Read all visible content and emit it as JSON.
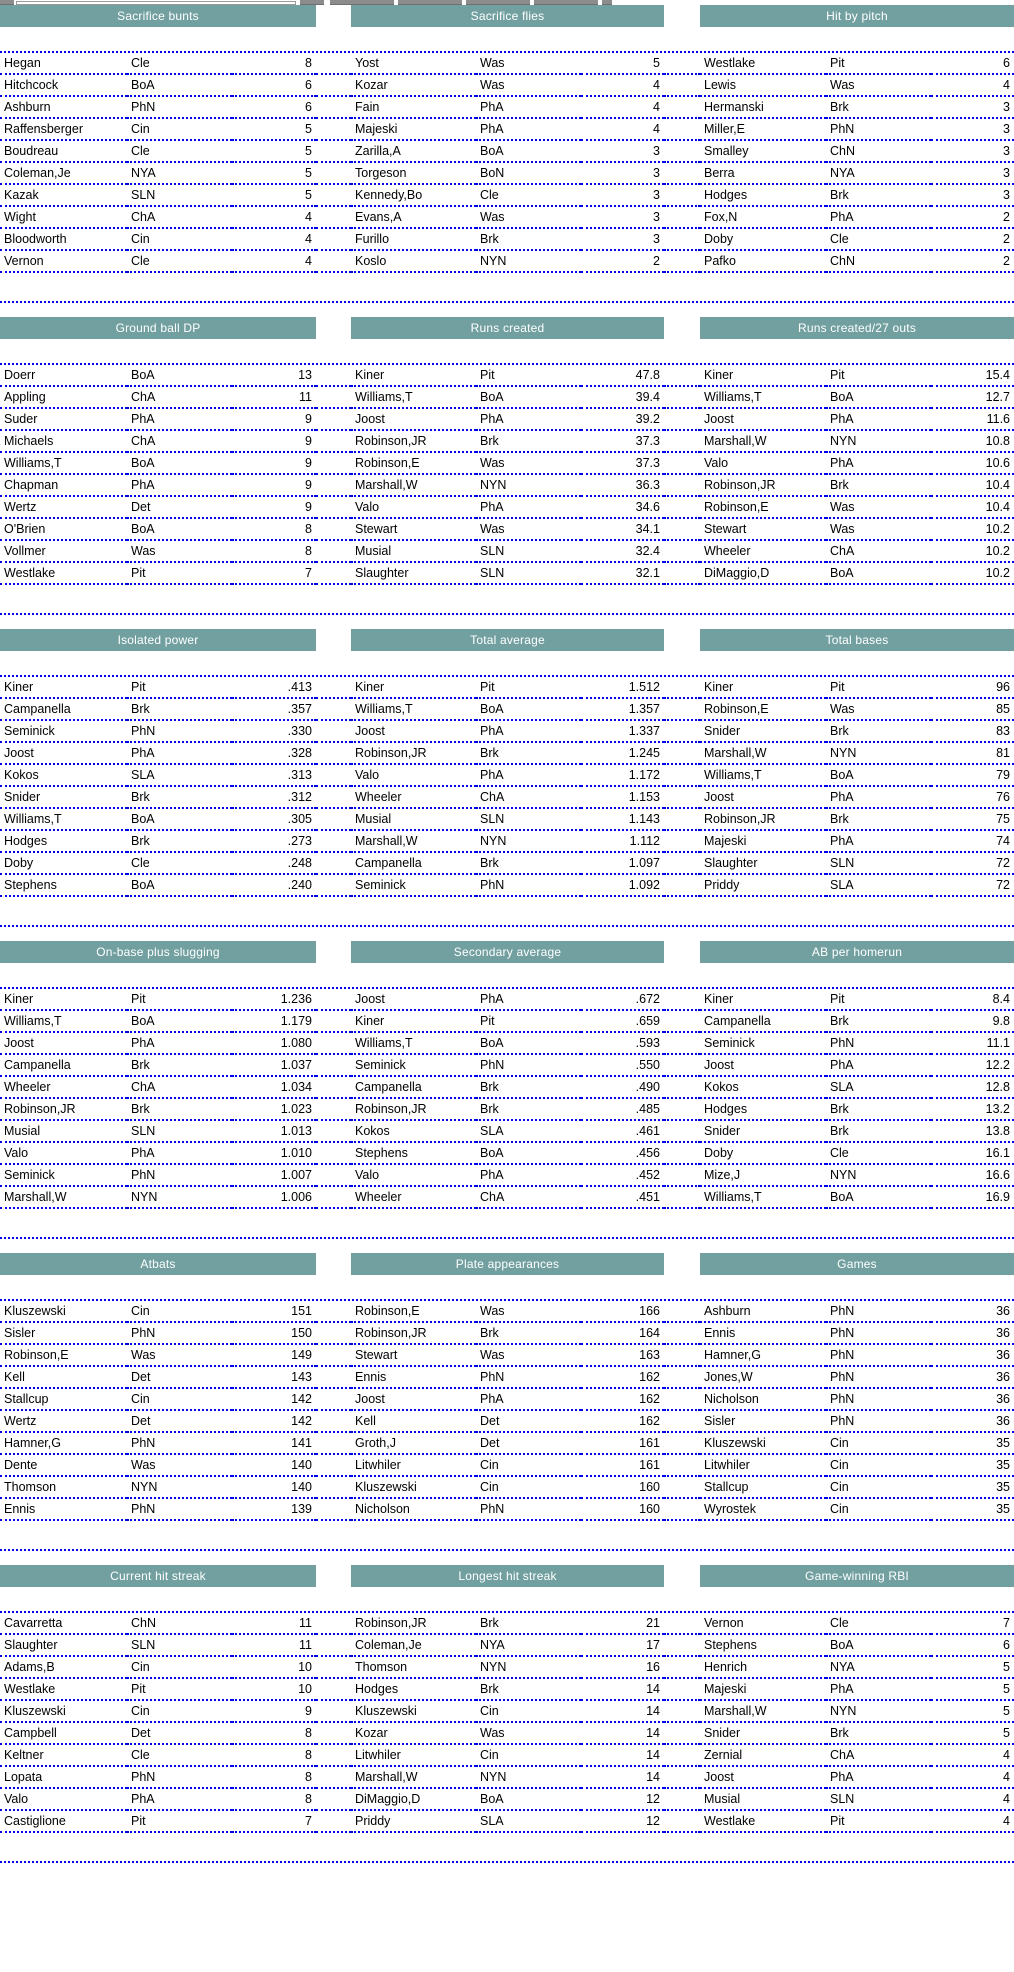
{
  "colors": {
    "header_teal": "#72a0a0",
    "grid_blue": "#0000ee",
    "text": "#000000"
  },
  "chrome": {
    "present": true
  },
  "sections": [
    {
      "id": "sec1",
      "titles": [
        "Sacrifice bunts",
        "Sacrifice flies",
        "Hit by pitch"
      ],
      "rows": [
        [
          "Hegan",
          "Cle",
          "8",
          "Yost",
          "Was",
          "5",
          "Westlake",
          "Pit",
          "6"
        ],
        [
          "Hitchcock",
          "BoA",
          "6",
          "Kozar",
          "Was",
          "4",
          "Lewis",
          "Was",
          "4"
        ],
        [
          "Ashburn",
          "PhN",
          "6",
          "Fain",
          "PhA",
          "4",
          "Hermanski",
          "Brk",
          "3"
        ],
        [
          "Raffensberger",
          "Cin",
          "5",
          "Majeski",
          "PhA",
          "4",
          "Miller,E",
          "PhN",
          "3"
        ],
        [
          "Boudreau",
          "Cle",
          "5",
          "Zarilla,A",
          "BoA",
          "3",
          "Smalley",
          "ChN",
          "3"
        ],
        [
          "Coleman,Je",
          "NYA",
          "5",
          "Torgeson",
          "BoN",
          "3",
          "Berra",
          "NYA",
          "3"
        ],
        [
          "Kazak",
          "SLN",
          "5",
          "Kennedy,Bo",
          "Cle",
          "3",
          "Hodges",
          "Brk",
          "3"
        ],
        [
          "Wight",
          "ChA",
          "4",
          "Evans,A",
          "Was",
          "3",
          "Fox,N",
          "PhA",
          "2"
        ],
        [
          "Bloodworth",
          "Cin",
          "4",
          "Furillo",
          "Brk",
          "3",
          "Doby",
          "Cle",
          "2"
        ],
        [
          "Vernon",
          "Cle",
          "4",
          "Koslo",
          "NYN",
          "2",
          "Pafko",
          "ChN",
          "2"
        ]
      ]
    },
    {
      "id": "sec2",
      "titles": [
        "Ground ball DP",
        "Runs created",
        "Runs created/27 outs"
      ],
      "rows": [
        [
          "Doerr",
          "BoA",
          "13",
          "Kiner",
          "Pit",
          "47.8",
          "Kiner",
          "Pit",
          "15.4"
        ],
        [
          "Appling",
          "ChA",
          "11",
          "Williams,T",
          "BoA",
          "39.4",
          "Williams,T",
          "BoA",
          "12.7"
        ],
        [
          "Suder",
          "PhA",
          "9",
          "Joost",
          "PhA",
          "39.2",
          "Joost",
          "PhA",
          "11.6"
        ],
        [
          "Michaels",
          "ChA",
          "9",
          "Robinson,JR",
          "Brk",
          "37.3",
          "Marshall,W",
          "NYN",
          "10.8"
        ],
        [
          "Williams,T",
          "BoA",
          "9",
          "Robinson,E",
          "Was",
          "37.3",
          "Valo",
          "PhA",
          "10.6"
        ],
        [
          "Chapman",
          "PhA",
          "9",
          "Marshall,W",
          "NYN",
          "36.3",
          "Robinson,JR",
          "Brk",
          "10.4"
        ],
        [
          "Wertz",
          "Det",
          "9",
          "Valo",
          "PhA",
          "34.6",
          "Robinson,E",
          "Was",
          "10.4"
        ],
        [
          "O'Brien",
          "BoA",
          "8",
          "Stewart",
          "Was",
          "34.1",
          "Stewart",
          "Was",
          "10.2"
        ],
        [
          "Vollmer",
          "Was",
          "8",
          "Musial",
          "SLN",
          "32.4",
          "Wheeler",
          "ChA",
          "10.2"
        ],
        [
          "Westlake",
          "Pit",
          "7",
          "Slaughter",
          "SLN",
          "32.1",
          "DiMaggio,D",
          "BoA",
          "10.2"
        ]
      ]
    },
    {
      "id": "sec3",
      "titles": [
        "Isolated power",
        "Total average",
        "Total bases"
      ],
      "rows": [
        [
          "Kiner",
          "Pit",
          ".413",
          "Kiner",
          "Pit",
          "1.512",
          "Kiner",
          "Pit",
          "96"
        ],
        [
          "Campanella",
          "Brk",
          ".357",
          "Williams,T",
          "BoA",
          "1.357",
          "Robinson,E",
          "Was",
          "85"
        ],
        [
          "Seminick",
          "PhN",
          ".330",
          "Joost",
          "PhA",
          "1.337",
          "Snider",
          "Brk",
          "83"
        ],
        [
          "Joost",
          "PhA",
          ".328",
          "Robinson,JR",
          "Brk",
          "1.245",
          "Marshall,W",
          "NYN",
          "81"
        ],
        [
          "Kokos",
          "SLA",
          ".313",
          "Valo",
          "PhA",
          "1.172",
          "Williams,T",
          "BoA",
          "79"
        ],
        [
          "Snider",
          "Brk",
          ".312",
          "Wheeler",
          "ChA",
          "1.153",
          "Joost",
          "PhA",
          "76"
        ],
        [
          "Williams,T",
          "BoA",
          ".305",
          "Musial",
          "SLN",
          "1.143",
          "Robinson,JR",
          "Brk",
          "75"
        ],
        [
          "Hodges",
          "Brk",
          ".273",
          "Marshall,W",
          "NYN",
          "1.112",
          "Majeski",
          "PhA",
          "74"
        ],
        [
          "Doby",
          "Cle",
          ".248",
          "Campanella",
          "Brk",
          "1.097",
          "Slaughter",
          "SLN",
          "72"
        ],
        [
          "Stephens",
          "BoA",
          ".240",
          "Seminick",
          "PhN",
          "1.092",
          "Priddy",
          "SLA",
          "72"
        ]
      ]
    },
    {
      "id": "sec4",
      "titles": [
        "On-base plus slugging",
        "Secondary average",
        "AB per homerun"
      ],
      "rows": [
        [
          "Kiner",
          "Pit",
          "1.236",
          "Joost",
          "PhA",
          ".672",
          "Kiner",
          "Pit",
          "8.4"
        ],
        [
          "Williams,T",
          "BoA",
          "1.179",
          "Kiner",
          "Pit",
          ".659",
          "Campanella",
          "Brk",
          "9.8"
        ],
        [
          "Joost",
          "PhA",
          "1.080",
          "Williams,T",
          "BoA",
          ".593",
          "Seminick",
          "PhN",
          "11.1"
        ],
        [
          "Campanella",
          "Brk",
          "1.037",
          "Seminick",
          "PhN",
          ".550",
          "Joost",
          "PhA",
          "12.2"
        ],
        [
          "Wheeler",
          "ChA",
          "1.034",
          "Campanella",
          "Brk",
          ".490",
          "Kokos",
          "SLA",
          "12.8"
        ],
        [
          "Robinson,JR",
          "Brk",
          "1.023",
          "Robinson,JR",
          "Brk",
          ".485",
          "Hodges",
          "Brk",
          "13.2"
        ],
        [
          "Musial",
          "SLN",
          "1.013",
          "Kokos",
          "SLA",
          ".461",
          "Snider",
          "Brk",
          "13.8"
        ],
        [
          "Valo",
          "PhA",
          "1.010",
          "Stephens",
          "BoA",
          ".456",
          "Doby",
          "Cle",
          "16.1"
        ],
        [
          "Seminick",
          "PhN",
          "1.007",
          "Valo",
          "PhA",
          ".452",
          "Mize,J",
          "NYN",
          "16.6"
        ],
        [
          "Marshall,W",
          "NYN",
          "1.006",
          "Wheeler",
          "ChA",
          ".451",
          "Williams,T",
          "BoA",
          "16.9"
        ]
      ]
    },
    {
      "id": "sec5",
      "titles": [
        "Atbats",
        "Plate appearances",
        "Games"
      ],
      "rows": [
        [
          "Kluszewski",
          "Cin",
          "151",
          "Robinson,E",
          "Was",
          "166",
          "Ashburn",
          "PhN",
          "36"
        ],
        [
          "Sisler",
          "PhN",
          "150",
          "Robinson,JR",
          "Brk",
          "164",
          "Ennis",
          "PhN",
          "36"
        ],
        [
          "Robinson,E",
          "Was",
          "149",
          "Stewart",
          "Was",
          "163",
          "Hamner,G",
          "PhN",
          "36"
        ],
        [
          "Kell",
          "Det",
          "143",
          "Ennis",
          "PhN",
          "162",
          "Jones,W",
          "PhN",
          "36"
        ],
        [
          "Stallcup",
          "Cin",
          "142",
          "Joost",
          "PhA",
          "162",
          "Nicholson",
          "PhN",
          "36"
        ],
        [
          "Wertz",
          "Det",
          "142",
          "Kell",
          "Det",
          "162",
          "Sisler",
          "PhN",
          "36"
        ],
        [
          "Hamner,G",
          "PhN",
          "141",
          "Groth,J",
          "Det",
          "161",
          "Kluszewski",
          "Cin",
          "35"
        ],
        [
          "Dente",
          "Was",
          "140",
          "Litwhiler",
          "Cin",
          "161",
          "Litwhiler",
          "Cin",
          "35"
        ],
        [
          "Thomson",
          "NYN",
          "140",
          "Kluszewski",
          "Cin",
          "160",
          "Stallcup",
          "Cin",
          "35"
        ],
        [
          "Ennis",
          "PhN",
          "139",
          "Nicholson",
          "PhN",
          "160",
          "Wyrostek",
          "Cin",
          "35"
        ]
      ]
    },
    {
      "id": "sec6",
      "titles": [
        "Current hit streak",
        "Longest hit streak",
        "Game-winning RBI"
      ],
      "rows": [
        [
          "Cavarretta",
          "ChN",
          "11",
          "Robinson,JR",
          "Brk",
          "21",
          "Vernon",
          "Cle",
          "7"
        ],
        [
          "Slaughter",
          "SLN",
          "11",
          "Coleman,Je",
          "NYA",
          "17",
          "Stephens",
          "BoA",
          "6"
        ],
        [
          "Adams,B",
          "Cin",
          "10",
          "Thomson",
          "NYN",
          "16",
          "Henrich",
          "NYA",
          "5"
        ],
        [
          "Westlake",
          "Pit",
          "10",
          "Hodges",
          "Brk",
          "14",
          "Majeski",
          "PhA",
          "5"
        ],
        [
          "Kluszewski",
          "Cin",
          "9",
          "Kluszewski",
          "Cin",
          "14",
          "Marshall,W",
          "NYN",
          "5"
        ],
        [
          "Campbell",
          "Det",
          "8",
          "Kozar",
          "Was",
          "14",
          "Snider",
          "Brk",
          "5"
        ],
        [
          "Keltner",
          "Cle",
          "8",
          "Litwhiler",
          "Cin",
          "14",
          "Zernial",
          "ChA",
          "4"
        ],
        [
          "Lopata",
          "PhN",
          "8",
          "Marshall,W",
          "NYN",
          "14",
          "Joost",
          "PhA",
          "4"
        ],
        [
          "Valo",
          "PhA",
          "8",
          "DiMaggio,D",
          "BoA",
          "12",
          "Musial",
          "SLN",
          "4"
        ],
        [
          "Castiglione",
          "Pit",
          "7",
          "Priddy",
          "SLA",
          "12",
          "Westlake",
          "Pit",
          "4"
        ]
      ]
    }
  ]
}
